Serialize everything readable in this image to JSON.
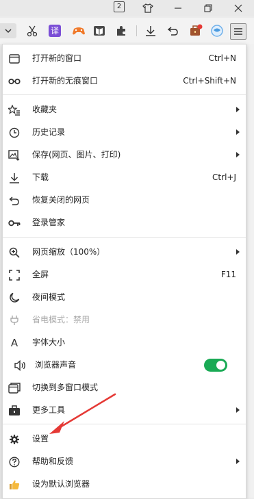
{
  "titlebar": {
    "tab_count": "2",
    "icons": [
      "tshirt-icon",
      "minimize-icon",
      "restore-icon",
      "close-icon"
    ]
  },
  "toolbar": {
    "icons": [
      "chevron-down-icon",
      "scissors-icon",
      "translate-icon",
      "game-icon",
      "reader-icon",
      "extensions-icon",
      "download-icon",
      "undo-icon",
      "toolbox-icon",
      "browser-logo-icon",
      "menu-icon"
    ],
    "translate_label": "译"
  },
  "menu": {
    "new_window": {
      "label": "打开新的窗口",
      "shortcut": "Ctrl+N"
    },
    "incognito": {
      "label": "打开新的无痕窗口",
      "shortcut": "Ctrl+Shift+N"
    },
    "favorites": {
      "label": "收藏夹"
    },
    "history": {
      "label": "历史记录"
    },
    "save": {
      "label": "保存(网页、图片、打印)"
    },
    "download": {
      "label": "下载",
      "shortcut": "Ctrl+J"
    },
    "restore_closed": {
      "label": "恢复关闭的网页"
    },
    "login_manager": {
      "label": "登录管家"
    },
    "zoom": {
      "label": "网页缩放（100%）"
    },
    "fullscreen": {
      "label": "全屏",
      "shortcut": "F11"
    },
    "night_mode": {
      "label": "夜间模式"
    },
    "power_save": {
      "label": "省电模式：禁用"
    },
    "font_size": {
      "label": "字体大小"
    },
    "sound": {
      "label": "浏览器声音",
      "enabled": true
    },
    "multi_window": {
      "label": "切换到多窗口模式"
    },
    "more_tools": {
      "label": "更多工具"
    },
    "settings": {
      "label": "设置"
    },
    "help": {
      "label": "帮助和反馈"
    },
    "default_browser": {
      "label": "设为默认浏览器"
    }
  },
  "colors": {
    "toggle_on": "#1aaa55",
    "annotation_arrow": "#e53935",
    "notification_dot": "#e53935"
  }
}
